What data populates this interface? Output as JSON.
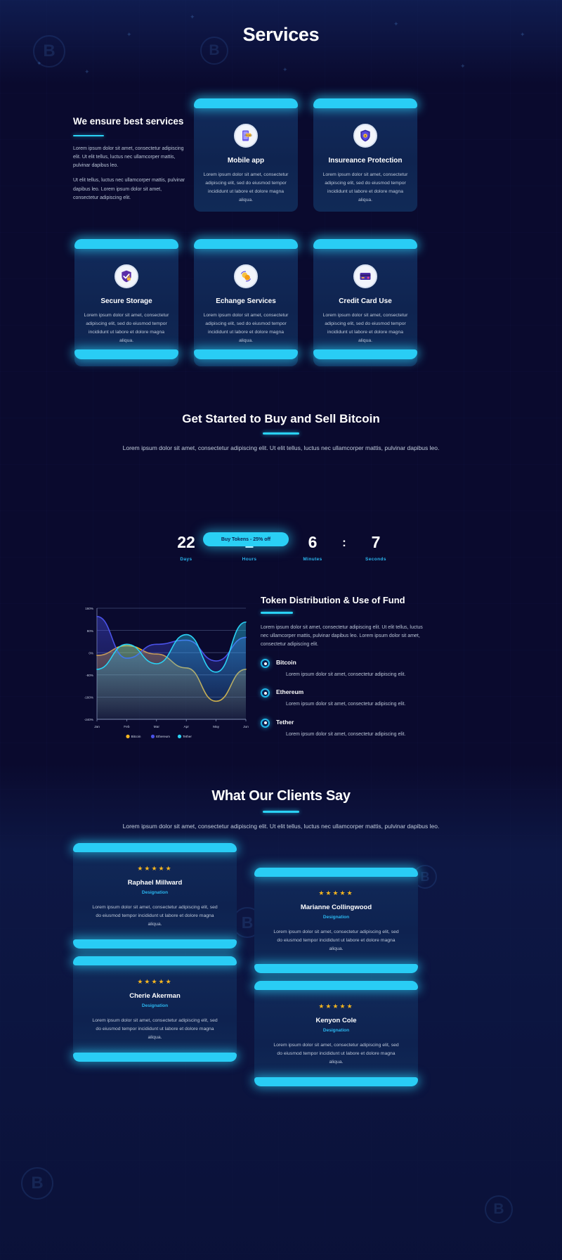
{
  "theme": {
    "accent": "#2ad2f5",
    "bg": "#0a0a2e",
    "card_bg": "#112a59",
    "star": "#f4b520",
    "text_muted": "#b9c4d6"
  },
  "services": {
    "title": "Services",
    "intro": {
      "heading": "We ensure best services",
      "paragraphs": [
        "Lorem ipsum dolor sit amet, consectetur adipiscing elit. Ut elit tellus, luctus nec ullamcorper mattis, pulvinar dapibus leo.",
        "Ut elit tellus, luctus nec ullamcorper mattis, pulvinar dapibus leo. Lorem ipsum dolor sit amet, consectetur adipiscing elit."
      ]
    },
    "cards": [
      {
        "icon": "mobile-app-icon",
        "glyph": "📱",
        "title": "Mobile app",
        "text": "Lorem ipsum dolor sit amet, consectetur adipiscing elit, sed do eiusmod tempor incididunt ut labore et dolore magna aliqua."
      },
      {
        "icon": "shield-lock-icon",
        "glyph": "🛡",
        "title": "Insureance Protection",
        "text": "Lorem ipsum dolor sit amet, consectetur adipiscing elit, sed do eiusmod tempor incididunt ut labore et dolore magna aliqua."
      },
      {
        "icon": "secure-storage-icon",
        "glyph": "✔",
        "title": "Secure Storage",
        "text": "Lorem ipsum dolor sit amet, consectetur adipiscing elit, sed do eiusmod tempor incididunt ut labore et dolore magna aliqua."
      },
      {
        "icon": "exchange-coins-icon",
        "glyph": "🔁",
        "title": "Echange Services",
        "text": "Lorem ipsum dolor sit amet, consectetur adipiscing elit, sed do eiusmod tempor incididunt ut labore et dolore magna aliqua."
      },
      {
        "icon": "credit-card-icon",
        "glyph": "💳",
        "title": "Credit Card Use",
        "text": "Lorem ipsum dolor sit amet, consectetur adipiscing elit, sed do eiusmod tempor incididunt ut labore et dolore magna aliqua."
      }
    ]
  },
  "cta": {
    "heading": "Get Started to Buy and Sell Bitcoin",
    "subtext": "Lorem ipsum dolor sit amet, consectetur adipiscing elit. Ut elit tellus, luctus nec ullamcorper mattis, pulvinar dapibus leo.",
    "countdown": {
      "separator": ":",
      "units": [
        {
          "value": "22",
          "label": "Days"
        },
        {
          "value": "2",
          "label": "Hours"
        },
        {
          "value": "6",
          "label": "Minutes"
        },
        {
          "value": "7",
          "label": "Seconds"
        }
      ]
    },
    "button_label": "Buy Tokens - 25% off"
  },
  "token_section": {
    "heading": "Token Distribution & Use of Fund",
    "description": "Lorem ipsum dolor sit amet, consectetur adipiscing elit. Ut elit tellus, luctus nec ullamcorper mattis, pulvinar dapibus leo. Lorem ipsum dolor sit amet, consectetur adipiscing elit.",
    "items": [
      {
        "name": "Bitcoin",
        "text": "Lorem ipsum dolor sit amet, consectetur adipiscing elit."
      },
      {
        "name": "Ethereum",
        "text": "Lorem ipsum dolor sit amet, consectetur adipiscing elit."
      },
      {
        "name": "Tether",
        "text": "Lorem ipsum dolor sit amet, consectetur adipiscing elit."
      }
    ]
  },
  "chart_data": {
    "type": "area",
    "title": "",
    "xlabel": "",
    "ylabel": "",
    "grid": true,
    "legend_position": "bottom",
    "categories": [
      "Jan",
      "Feb",
      "Mar",
      "Apr",
      "May",
      "Jun"
    ],
    "x": [
      "Jan",
      "Feb",
      "Mar",
      "Apr",
      "May",
      "Jun"
    ],
    "ytick_labels": [
      "160%",
      "80%",
      "0%",
      "-80%",
      "-160%",
      "-240%"
    ],
    "ylim": [
      -240,
      160
    ],
    "series": [
      {
        "name": "Bitcoin",
        "color": "#f4b520",
        "values": [
          -10,
          25,
          -5,
          -55,
          -175,
          -60
        ]
      },
      {
        "name": "Ethereum",
        "color": "#4a52e8",
        "values": [
          130,
          -20,
          30,
          45,
          -30,
          55
        ]
      },
      {
        "name": "Tether",
        "color": "#2ad2f5",
        "values": [
          -60,
          30,
          -40,
          65,
          -70,
          110
        ]
      }
    ]
  },
  "testimonials": {
    "heading": "What Our Clients Say",
    "subtext": "Lorem ipsum dolor sit amet, consectetur adipiscing elit. Ut elit tellus, luctus nec ullamcorper mattis, pulvinar dapibus leo.",
    "cards": [
      {
        "stars": "★★★★★",
        "name": "Raphael Millward",
        "designation": "Designation",
        "text": "Lorem ipsum dolor sit amet, consectetur adipiscing elit, sed do eiusmod tempor incididunt ut labore et dolore magna aliqua."
      },
      {
        "stars": "★★★★★",
        "name": "Marianne Collingwood",
        "designation": "Designation",
        "text": "Lorem ipsum dolor sit amet, consectetur adipiscing elit, sed do eiusmod tempor incididunt ut labore et dolore magna aliqua."
      },
      {
        "stars": "★★★★★",
        "name": "Cherie Akerman",
        "designation": "Designation",
        "text": "Lorem ipsum dolor sit amet, consectetur adipiscing elit, sed do eiusmod tempor incididunt ut labore et dolore magna aliqua."
      },
      {
        "stars": "★★★★★",
        "name": "Kenyon Cole",
        "designation": "Designation",
        "text": "Lorem ipsum dolor sit amet, consectetur adipiscing elit, sed do eiusmod tempor incididunt ut labore et dolore magna aliqua."
      }
    ]
  }
}
